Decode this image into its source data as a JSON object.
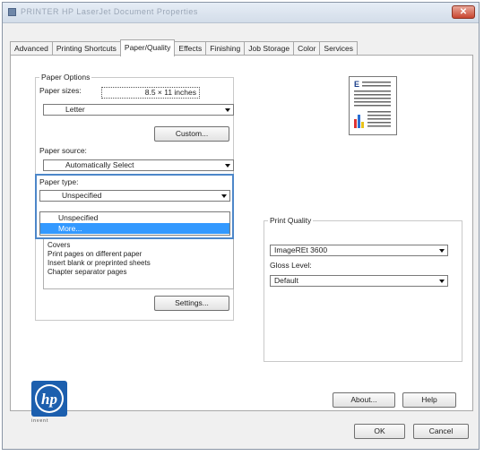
{
  "window": {
    "title": "PRINTER HP LaserJet Document Properties",
    "close_symbol": "✕"
  },
  "tabs": [
    {
      "label": "Advanced",
      "active": false
    },
    {
      "label": "Printing Shortcuts",
      "active": false
    },
    {
      "label": "Paper/Quality",
      "active": true
    },
    {
      "label": "Effects",
      "active": false
    },
    {
      "label": "Finishing",
      "active": false
    },
    {
      "label": "Job Storage",
      "active": false
    },
    {
      "label": "Color",
      "active": false
    },
    {
      "label": "Services",
      "active": false
    }
  ],
  "paper_options": {
    "group_title": "Paper Options",
    "paper_sizes_label": "Paper sizes:",
    "paper_size_dimensions": "8.5 × 11 inches",
    "paper_size_value": "Letter",
    "custom_button": "Custom...",
    "paper_source_label": "Paper source:",
    "paper_source_value": "Automatically Select",
    "paper_type_label": "Paper type:",
    "paper_type_value": "Unspecified",
    "paper_type_options": [
      {
        "label": "Unspecified",
        "selected": false
      },
      {
        "label": "More...",
        "selected": true
      }
    ],
    "special_pages": [
      "Covers",
      "Print pages on different paper",
      "Insert blank or preprinted sheets",
      "Chapter separator pages"
    ],
    "settings_button": "Settings..."
  },
  "print_quality": {
    "group_title": "Print Quality",
    "quality_value": "ImageREt 3600",
    "gloss_label": "Gloss Level:",
    "gloss_value": "Default"
  },
  "brand": {
    "logo_text": "hp",
    "tagline": "invent"
  },
  "panel_buttons": {
    "about": "About...",
    "help": "Help"
  },
  "dialog_buttons": {
    "ok": "OK",
    "cancel": "Cancel"
  },
  "colors": {
    "accent": "#3399ff",
    "highlight_border": "#4d87c9",
    "hp_blue": "#1c5fae"
  }
}
